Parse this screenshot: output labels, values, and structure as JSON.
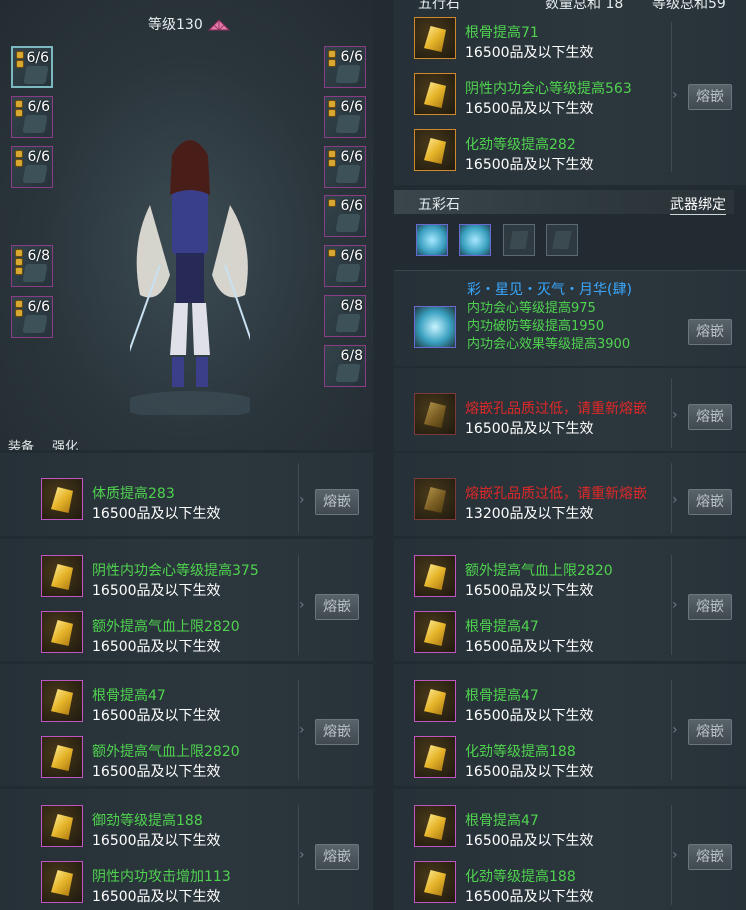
{
  "character": {
    "level_label": "等级130",
    "tabs": [
      "装备",
      "强化"
    ],
    "left_slots": [
      "6/6",
      "6/6",
      "6/6",
      "6/8",
      "6/6"
    ],
    "right_slots": [
      "6/6",
      "6/6",
      "6/6",
      "6/6",
      "6/6",
      "6/8",
      "6/8"
    ]
  },
  "top_header": {
    "title": "五行石",
    "total": "数量总和 18",
    "level_total": "等级总和59"
  },
  "socket_button_label": "熔嵌",
  "right_group1": [
    {
      "line1": "根骨提高71",
      "line2": "16500品及以下生效"
    },
    {
      "line1": "阴性内功会心等级提高563",
      "line2": "16500品及以下生效"
    },
    {
      "line1": "化劲等级提高282",
      "line2": "16500品及以下生效"
    }
  ],
  "wucai": {
    "title": "五彩石",
    "bind": "武器绑定",
    "name": "彩・星见・灭气・月华(肆)",
    "effects": [
      "内功会心等级提高975",
      "内功破防等级提高1950",
      "内功会心效果等级提高3900"
    ]
  },
  "right_warn1": {
    "line1": "熔嵌孔品质过低，请重新熔嵌",
    "line2": "16500品及以下生效"
  },
  "right_warn2": {
    "line1": "熔嵌孔品质过低，请重新熔嵌",
    "line2": "13200品及以下生效"
  },
  "left_single": {
    "line1": "体质提高283",
    "line2": "16500品及以下生效"
  },
  "left_pairs": [
    [
      {
        "line1": "阴性内功会心等级提高375",
        "line2": "16500品及以下生效"
      },
      {
        "line1": "额外提高气血上限2820",
        "line2": "16500品及以下生效"
      }
    ],
    [
      {
        "line1": "根骨提高47",
        "line2": "16500品及以下生效"
      },
      {
        "line1": "额外提高气血上限2820",
        "line2": "16500品及以下生效"
      }
    ],
    [
      {
        "line1": "御劲等级提高188",
        "line2": "16500品及以下生效"
      },
      {
        "line1": "阴性内功攻击增加113",
        "line2": "16500品及以下生效"
      }
    ]
  ],
  "right_pairs": [
    [
      {
        "line1": "额外提高气血上限2820",
        "line2": "16500品及以下生效"
      },
      {
        "line1": "根骨提高47",
        "line2": "16500品及以下生效"
      }
    ],
    [
      {
        "line1": "根骨提高47",
        "line2": "16500品及以下生效"
      },
      {
        "line1": "化劲等级提高188",
        "line2": "16500品及以下生效"
      }
    ],
    [
      {
        "line1": "根骨提高47",
        "line2": "16500品及以下生效"
      },
      {
        "line1": "化劲等级提高188",
        "line2": "16500品及以下生效"
      }
    ]
  ],
  "colors": {
    "effect_green": "#4fd34f",
    "warning_red": "#e02828",
    "wucai_blue": "#3aa8ff",
    "slot_border": "#c054c0"
  }
}
